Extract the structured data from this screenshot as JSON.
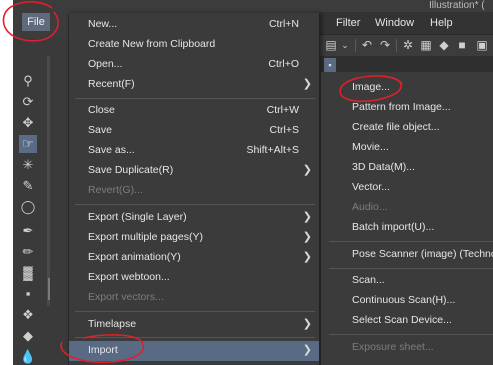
{
  "window": {
    "title": "Illustration* ("
  },
  "file_tab": {
    "label": "File"
  },
  "menubar": {
    "items": [
      "Filter",
      "Window",
      "Help"
    ]
  },
  "toolbar": {
    "icons": [
      "layer-icon",
      "undo-icon",
      "redo-icon",
      "loading-icon",
      "transform-icon",
      "fill-icon",
      "crop-icon"
    ]
  },
  "canvas_tab": {
    "label": "▪"
  },
  "tools": [
    "magnifier-icon",
    "move-rotate-icon",
    "move-icon",
    "operation-icon",
    "auto-select-icon",
    "eyedropper-icon",
    "lasso-icon",
    "pen-icon",
    "pencil-icon",
    "brush-icon",
    "airbrush-icon",
    "decoration-icon",
    "eraser-icon",
    "blend-icon"
  ],
  "file_menu": {
    "items": [
      {
        "label": "New...",
        "shortcut": "Ctrl+N",
        "submenu": false,
        "enabled": true
      },
      {
        "label": "Create New from Clipboard",
        "shortcut": "",
        "submenu": false,
        "enabled": true
      },
      {
        "label": "Open...",
        "shortcut": "Ctrl+O",
        "submenu": false,
        "enabled": true
      },
      {
        "label": "Recent(F)",
        "shortcut": "",
        "submenu": true,
        "enabled": true
      },
      {
        "label": "Close",
        "shortcut": "Ctrl+W",
        "submenu": false,
        "enabled": true
      },
      {
        "label": "Save",
        "shortcut": "Ctrl+S",
        "submenu": false,
        "enabled": true
      },
      {
        "label": "Save as...",
        "shortcut": "Shift+Alt+S",
        "submenu": false,
        "enabled": true
      },
      {
        "label": "Save Duplicate(R)",
        "shortcut": "",
        "submenu": true,
        "enabled": true
      },
      {
        "label": "Revert(G)...",
        "shortcut": "",
        "submenu": false,
        "enabled": false
      },
      {
        "label": "Export (Single Layer)",
        "shortcut": "",
        "submenu": true,
        "enabled": true
      },
      {
        "label": "Export multiple pages(Y)",
        "shortcut": "",
        "submenu": true,
        "enabled": true
      },
      {
        "label": "Export animation(Y)",
        "shortcut": "",
        "submenu": true,
        "enabled": true
      },
      {
        "label": "Export webtoon...",
        "shortcut": "",
        "submenu": false,
        "enabled": true
      },
      {
        "label": "Export vectors...",
        "shortcut": "",
        "submenu": false,
        "enabled": false
      },
      {
        "label": "Timelapse",
        "shortcut": "",
        "submenu": true,
        "enabled": true
      },
      {
        "label": "Import",
        "shortcut": "",
        "submenu": true,
        "enabled": true,
        "active": true
      }
    ]
  },
  "import_submenu": {
    "items": [
      {
        "label": "Image...",
        "enabled": true
      },
      {
        "label": "Pattern from Image...",
        "enabled": true
      },
      {
        "label": "Create file object...",
        "enabled": true
      },
      {
        "label": "Movie...",
        "enabled": true
      },
      {
        "label": "3D Data(M)...",
        "enabled": true
      },
      {
        "label": "Vector...",
        "enabled": true
      },
      {
        "label": "Audio...",
        "enabled": false
      },
      {
        "label": "Batch import(U)...",
        "enabled": true
      },
      {
        "label": "Pose Scanner (image) (Technolog",
        "enabled": true
      },
      {
        "label": "Scan...",
        "enabled": true
      },
      {
        "label": "Continuous Scan(H)...",
        "enabled": true
      },
      {
        "label": "Select Scan Device...",
        "enabled": true
      },
      {
        "label": "Exposure sheet...",
        "enabled": false
      }
    ]
  },
  "colors": {
    "menu_bg": "#3b3b3b",
    "highlight": "#596a85",
    "annotation": "#e0202a",
    "disabled_text": "#7d7d7d"
  }
}
